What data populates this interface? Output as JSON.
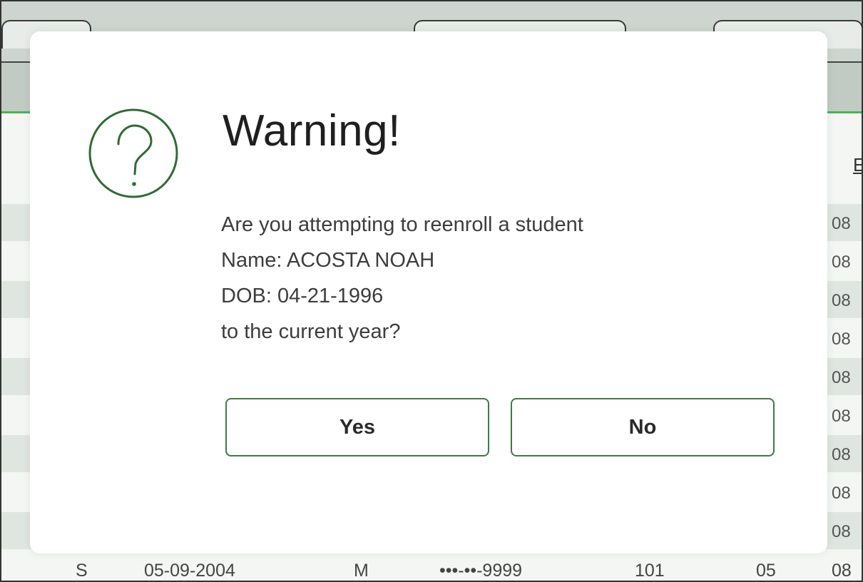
{
  "background": {
    "header_link_partial": "E",
    "right_column_values": [
      "08",
      "08",
      "08",
      "08",
      "08",
      "08",
      "08",
      "08",
      "08",
      "08"
    ],
    "bottom_row": [
      "S",
      "05-09-2004",
      "M",
      "•••-••-9999",
      "101",
      "05",
      "08"
    ]
  },
  "dialog": {
    "icon": "question-circle-icon",
    "title": "Warning!",
    "message_lines": [
      "Are you attempting to reenroll a student",
      "Name: ACOSTA NOAH",
      "DOB: 04-21-1996",
      "to the current year?"
    ],
    "yes_label": "Yes",
    "no_label": "No"
  },
  "colors": {
    "accent_green": "#2f6b35",
    "button_border": "#3f7a45",
    "header_rule": "#4fb05a"
  }
}
